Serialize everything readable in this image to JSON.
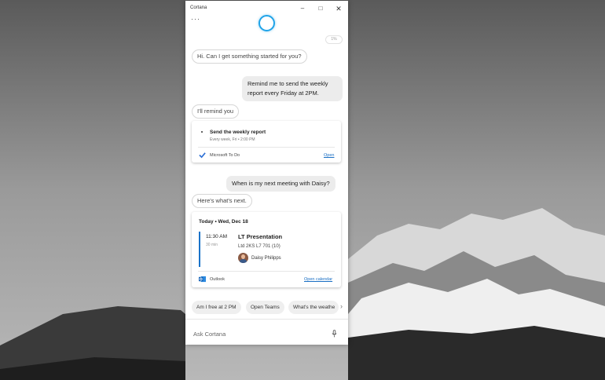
{
  "window": {
    "title": "Cortana",
    "more_label": "···"
  },
  "chat": {
    "top_chip": "1%",
    "greeting": "Hi. Can I get something started for you?",
    "user_msg_1_line1": "Remind me to send the weekly",
    "user_msg_1_line2": "report every Friday at 2PM.",
    "reply_1": "I'll remind you",
    "reminder": {
      "title": "Send the weekly report",
      "subtitle": "Every week, Fri • 2:00 PM",
      "app": "Microsoft To Do",
      "link": "Open",
      "icon": "checkmark-icon"
    },
    "user_msg_2": "When is my next meeting with Daisy?",
    "reply_2": "Here's what's next.",
    "meeting": {
      "date": "Today • Wed, Dec 18",
      "time": "11:30 AM",
      "duration": "30 min",
      "title": "LT Presentation",
      "room": "Ltd 2KS L7 701 (10)",
      "person": "Daisy Philipps",
      "app": "Outlook",
      "link": "Open calendar",
      "icon": "outlook-icon"
    }
  },
  "suggestions": [
    "Am I free at 2 PM",
    "Open Teams",
    "What's the weathe"
  ],
  "input": {
    "placeholder": "Ask Cortana",
    "mic_icon": "microphone-icon"
  },
  "colors": {
    "accent": "#1a73c9",
    "cortana_ring": "#1fa3e8"
  }
}
